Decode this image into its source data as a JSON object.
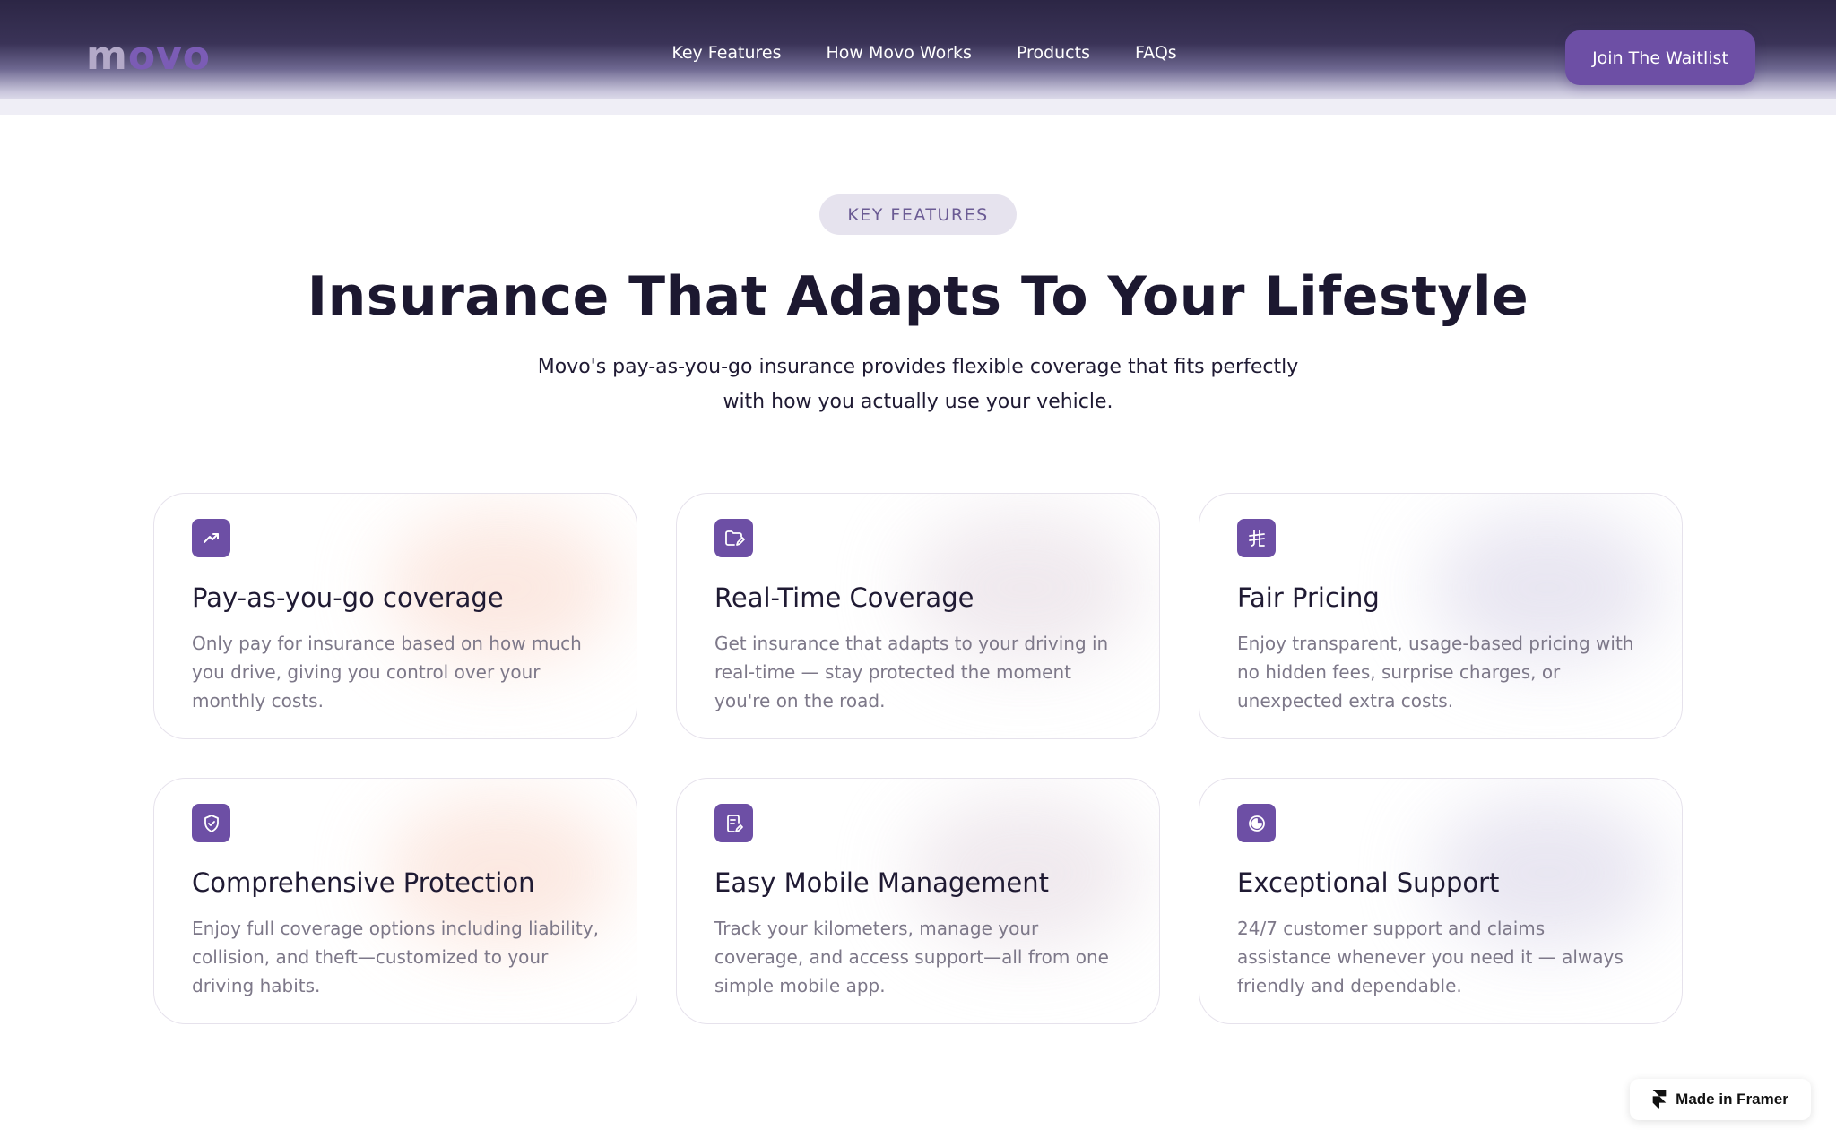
{
  "brand": {
    "logo_text": "movo",
    "accent": "#6d4fa5"
  },
  "nav": {
    "items": [
      {
        "label": "Key Features"
      },
      {
        "label": "How Movo Works"
      },
      {
        "label": "Products"
      },
      {
        "label": "FAQs"
      }
    ],
    "cta_label": "Join The Waitlist"
  },
  "hero": {
    "eyebrow": "KEY FEATURES",
    "title": "Insurance That Adapts To Your Lifestyle",
    "subtitle_line1": "Movo's pay-as-you-go insurance provides flexible coverage that fits perfectly",
    "subtitle_line2": "with how you actually use your vehicle."
  },
  "features": [
    {
      "icon": "trend-up-icon",
      "title": "Pay-as-you-go coverage",
      "description": "Only pay for insurance based on how much you drive, giving you control over your monthly costs.",
      "glow": "#fbe3da"
    },
    {
      "icon": "folder-edit-icon",
      "title": "Real-Time Coverage",
      "description": "Get insurance that adapts to your driving in real-time — stay protected the moment you're on the road.",
      "glow": "#ece4ea"
    },
    {
      "icon": "pricing-icon",
      "title": "Fair Pricing",
      "description": "Enjoy transparent, usage-based pricing with no hidden fees, surprise charges, or unexpected extra costs.",
      "glow": "#e3e0ee"
    },
    {
      "icon": "shield-check-icon",
      "title": "Comprehensive Protection",
      "description": "Enjoy full coverage options including liability, collision, and theft—customized to your driving habits.",
      "glow": "#fbe3da"
    },
    {
      "icon": "mobile-edit-icon",
      "title": "Easy Mobile Management",
      "description": "Track your kilometers, manage your coverage, and access support—all from one simple mobile app.",
      "glow": "#ece4ea"
    },
    {
      "icon": "support-clock-icon",
      "title": "Exceptional Support",
      "description": "24/7 customer support and claims assistance whenever you need it — always friendly and dependable.",
      "glow": "#e3e0ee"
    }
  ],
  "framer_badge": "Made in Framer"
}
